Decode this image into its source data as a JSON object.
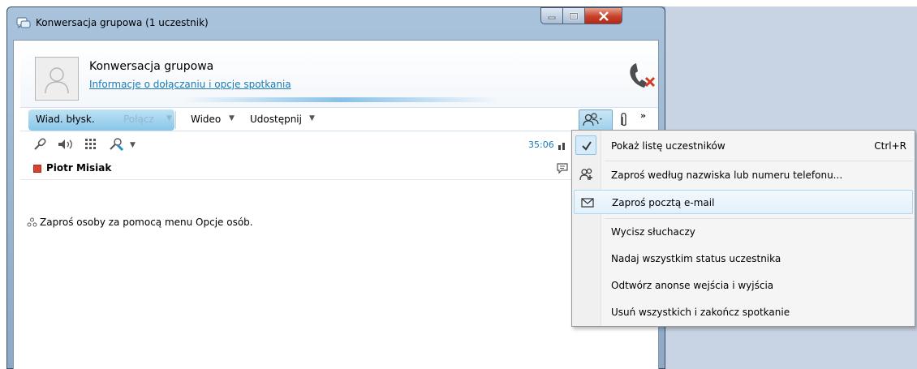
{
  "window": {
    "title": "Konwersacja grupowa (1 uczestnik)"
  },
  "header": {
    "title": "Konwersacja grupowa",
    "link": "Informacje o dołączaniu i opcje spotkania"
  },
  "toolbar": {
    "im_label": "Wiad. błysk.",
    "call_label": "Połącz",
    "video_label": "Wideo",
    "share_label": "Udostępnij",
    "more_label": "»"
  },
  "controls": {
    "timer": "35:06"
  },
  "participant": {
    "name": "Piotr Misiak"
  },
  "body": {
    "message": "Zaproś osoby za pomocą menu Opcje osób."
  },
  "menu": {
    "items": [
      {
        "label": "Pokaż listę uczestników",
        "shortcut": "Ctrl+R",
        "checked": true
      },
      {
        "label": "Zaproś według nazwiska lub numeru telefonu..."
      },
      {
        "label": "Zaproś pocztą e-mail",
        "highlighted": true
      },
      {
        "label": "Wycisz słuchaczy"
      },
      {
        "label": "Nadaj wszystkim status uczestnika"
      },
      {
        "label": "Odtwórz anonse wejścia i wyjścia"
      },
      {
        "label": "Usuń wszystkich i zakończ spotkanie"
      }
    ]
  },
  "colors": {
    "accent": "#1a7ab8",
    "status_busy": "#d9412b",
    "menu_highlight": "#e3f1fb"
  },
  "icons": [
    "lync-conversation-icon",
    "avatar-placeholder-icon",
    "hangup-icon",
    "people-options-icon",
    "paperclip-icon",
    "microphone-icon",
    "speaker-icon",
    "dialpad-icon",
    "transfer-icon",
    "signal-icon",
    "chat-icon",
    "checkmark-icon",
    "invite-person-icon",
    "envelope-icon"
  ]
}
